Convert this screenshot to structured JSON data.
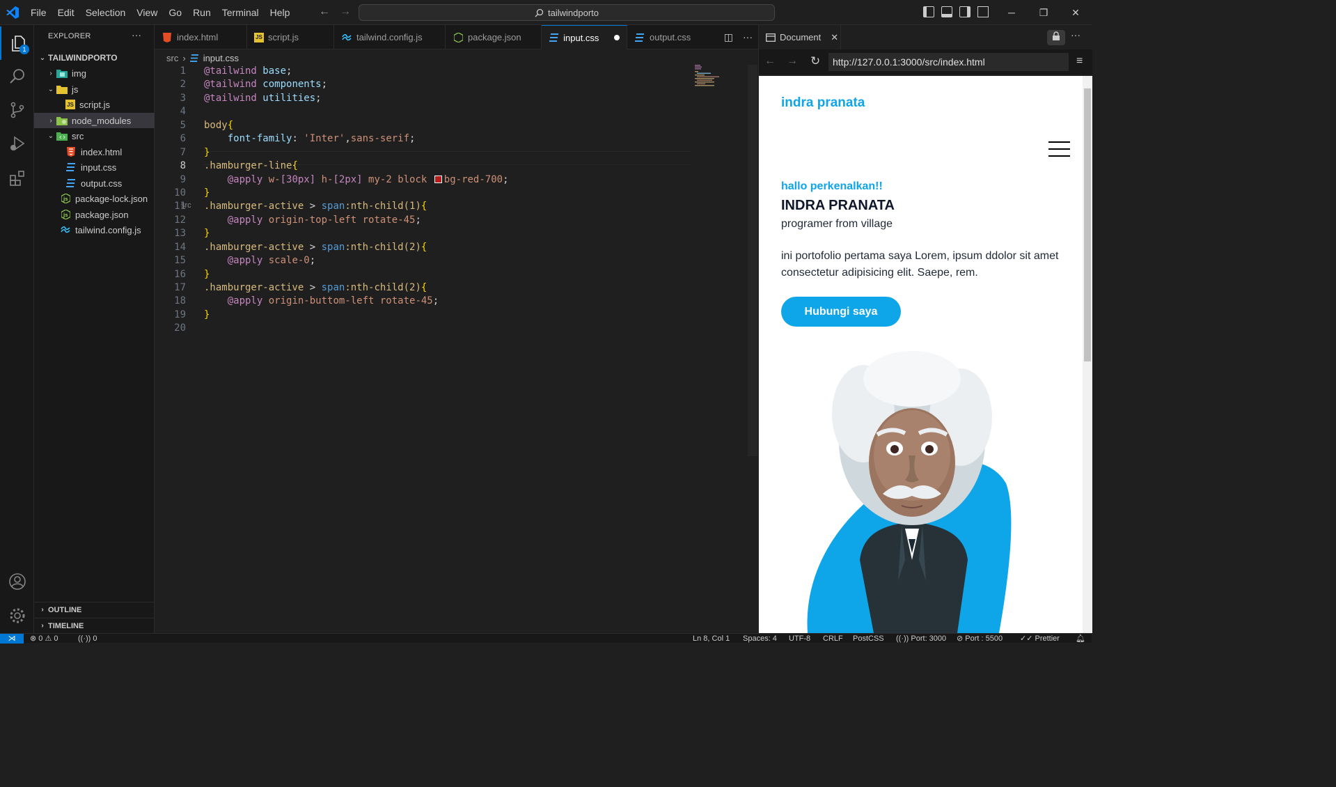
{
  "titlebar": {
    "menu": [
      "File",
      "Edit",
      "Selection",
      "View",
      "Go",
      "Run",
      "Terminal",
      "Help"
    ],
    "search": "tailwindporto"
  },
  "activity": {
    "explorer_badge": "1"
  },
  "explorer": {
    "title": "EXPLORER",
    "root": "TAILWINDPORTO",
    "items": [
      {
        "label": "img",
        "kind": "folder",
        "icon": "image-folder-icon"
      },
      {
        "label": "js",
        "kind": "folder-open",
        "icon": "js-folder-icon"
      },
      {
        "label": "script.js",
        "kind": "file",
        "icon": "js-file-icon"
      },
      {
        "label": "node_modules",
        "kind": "folder",
        "icon": "node-folder-icon"
      },
      {
        "label": "src",
        "kind": "folder-open",
        "icon": "src-folder-icon"
      },
      {
        "label": "index.html",
        "kind": "file",
        "icon": "html-file-icon"
      },
      {
        "label": "input.css",
        "kind": "file",
        "icon": "css-file-icon"
      },
      {
        "label": "output.css",
        "kind": "file",
        "icon": "css-file-icon"
      },
      {
        "label": "package-lock.json",
        "kind": "file",
        "icon": "node-json-icon"
      },
      {
        "label": "package.json",
        "kind": "file",
        "icon": "node-json-icon"
      },
      {
        "label": "tailwind.config.js",
        "kind": "file",
        "icon": "tailwind-icon"
      }
    ],
    "outline": "OUTLINE",
    "timeline": "TIMELINE"
  },
  "tabs": [
    {
      "label": "index.html",
      "desc": "src"
    },
    {
      "label": "script.js"
    },
    {
      "label": "tailwind.config.js"
    },
    {
      "label": "package.json"
    },
    {
      "label": "input.css"
    },
    {
      "label": "output.css"
    }
  ],
  "breadcrumb": {
    "folder": "src",
    "file": "input.css"
  },
  "code": {
    "current_line": 8,
    "lines": [
      [
        [
          "@tailwind",
          "at"
        ],
        [
          " ",
          "plain"
        ],
        [
          "base",
          "prop"
        ],
        [
          ";",
          "plain"
        ]
      ],
      [
        [
          "@tailwind",
          "at"
        ],
        [
          " ",
          "plain"
        ],
        [
          "components",
          "prop"
        ],
        [
          ";",
          "plain"
        ]
      ],
      [
        [
          "@tailwind",
          "at"
        ],
        [
          " ",
          "plain"
        ],
        [
          "utilities",
          "prop"
        ],
        [
          ";",
          "plain"
        ]
      ],
      [],
      [
        [
          "body",
          "sel"
        ],
        [
          "{",
          "br"
        ]
      ],
      [
        [
          "    ",
          "plain"
        ],
        [
          "font-family",
          "prop"
        ],
        [
          ": ",
          "plain"
        ],
        [
          "'Inter'",
          "str"
        ],
        [
          ",",
          "plain"
        ],
        [
          "sans-serif",
          "val"
        ],
        [
          ";",
          "plain"
        ]
      ],
      [
        [
          "}",
          "br"
        ]
      ],
      [
        [
          ".hamburger-line",
          "sel"
        ],
        [
          "{",
          "br"
        ]
      ],
      [
        [
          "    ",
          "plain"
        ],
        [
          "@apply",
          "at"
        ],
        [
          " w-",
          "val"
        ],
        [
          "[30px]",
          "at"
        ],
        [
          " h-",
          "val"
        ],
        [
          "[2px]",
          "at"
        ],
        [
          " my-2 block ",
          "val"
        ],
        [
          "",
          "swatch"
        ],
        [
          "bg-red-700",
          "val"
        ],
        [
          ";",
          "plain"
        ]
      ],
      [
        [
          "}",
          "br"
        ]
      ],
      [
        [
          ".hamburger-active",
          "sel"
        ],
        [
          " > ",
          "plain"
        ],
        [
          "span",
          "tag"
        ],
        [
          ":nth-child(1)",
          "sel"
        ],
        [
          "{",
          "br"
        ]
      ],
      [
        [
          "    ",
          "plain"
        ],
        [
          "@apply",
          "at"
        ],
        [
          " origin-top-left rotate-45",
          "val"
        ],
        [
          ";",
          "plain"
        ]
      ],
      [
        [
          "}",
          "br"
        ]
      ],
      [
        [
          ".hamburger-active",
          "sel"
        ],
        [
          " > ",
          "plain"
        ],
        [
          "span",
          "tag"
        ],
        [
          ":nth-child(2)",
          "sel"
        ],
        [
          "{",
          "br"
        ]
      ],
      [
        [
          "    ",
          "plain"
        ],
        [
          "@apply",
          "at"
        ],
        [
          " scale-0",
          "val"
        ],
        [
          ";",
          "plain"
        ]
      ],
      [
        [
          "}",
          "br"
        ]
      ],
      [
        [
          ".hamburger-active",
          "sel"
        ],
        [
          " > ",
          "plain"
        ],
        [
          "span",
          "tag"
        ],
        [
          ":nth-child(2)",
          "sel"
        ],
        [
          "{",
          "br"
        ]
      ],
      [
        [
          "    ",
          "plain"
        ],
        [
          "@apply",
          "at"
        ],
        [
          " origin-buttom-left rotate-45",
          "val"
        ],
        [
          ";",
          "plain"
        ]
      ],
      [
        [
          "}",
          "br"
        ]
      ],
      []
    ]
  },
  "browser": {
    "tab_label": "Document",
    "url": "http://127.0.0.1:3000/src/index.html",
    "page": {
      "logo": "indra pranata",
      "greeting": "hallo perkenalkan!!",
      "name": "INDRA PRANATA",
      "role": "programer from village",
      "description": "ini portofolio pertama saya Lorem, ipsum ddolor sit amet consectetur adipisicing elit. Saepe, rem.",
      "cta": "Hubungi saya",
      "accent": "#0ea5e9"
    }
  },
  "statusbar": {
    "errors": "0",
    "warnings": "0",
    "ports": "0",
    "position": "Ln 8, Col 1",
    "spaces": "Spaces: 4",
    "encoding": "UTF-8",
    "eol": "CRLF",
    "language": "PostCSS",
    "port": "Port: 3000",
    "live": "Port : 5500",
    "formatter": "Prettier"
  }
}
